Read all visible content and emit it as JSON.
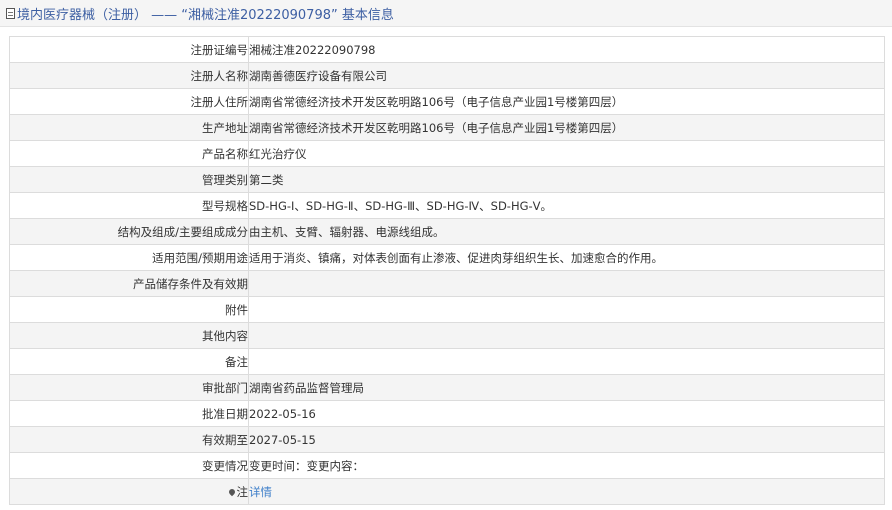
{
  "header": {
    "title": "境内医疗器械（注册） —— “湘械注准20222090798” 基本信息"
  },
  "rows": [
    {
      "label": "注册证编号",
      "value": "湘械注准20222090798"
    },
    {
      "label": "注册人名称",
      "value": "湖南善德医疗设备有限公司"
    },
    {
      "label": "注册人住所",
      "value": "湖南省常德经济技术开发区乾明路106号（电子信息产业园1号楼第四层）"
    },
    {
      "label": "生产地址",
      "value": "湖南省常德经济技术开发区乾明路106号（电子信息产业园1号楼第四层）"
    },
    {
      "label": "产品名称",
      "value": "红光治疗仪"
    },
    {
      "label": "管理类别",
      "value": "第二类"
    },
    {
      "label": "型号规格",
      "value": "SD-HG-Ⅰ、SD-HG-Ⅱ、SD-HG-Ⅲ、SD-HG-Ⅳ、SD-HG-Ⅴ。"
    },
    {
      "label": "结构及组成/主要组成成分",
      "value": "由主机、支臂、辐射器、电源线组成。"
    },
    {
      "label": "适用范围/预期用途",
      "value": "适用于消炎、镇痛，对体表创面有止渗液、促进肉芽组织生长、加速愈合的作用。"
    },
    {
      "label": "产品储存条件及有效期",
      "value": ""
    },
    {
      "label": "附件",
      "value": ""
    },
    {
      "label": "其他内容",
      "value": ""
    },
    {
      "label": "备注",
      "value": ""
    },
    {
      "label": "审批部门",
      "value": "湖南省药品监督管理局"
    },
    {
      "label": "批准日期",
      "value": "2022-05-16"
    },
    {
      "label": "有效期至",
      "value": "2027-05-15"
    },
    {
      "label": "变更情况",
      "value": "变更时间：变更内容："
    }
  ],
  "note_row": {
    "label": "注",
    "link": "详情"
  }
}
